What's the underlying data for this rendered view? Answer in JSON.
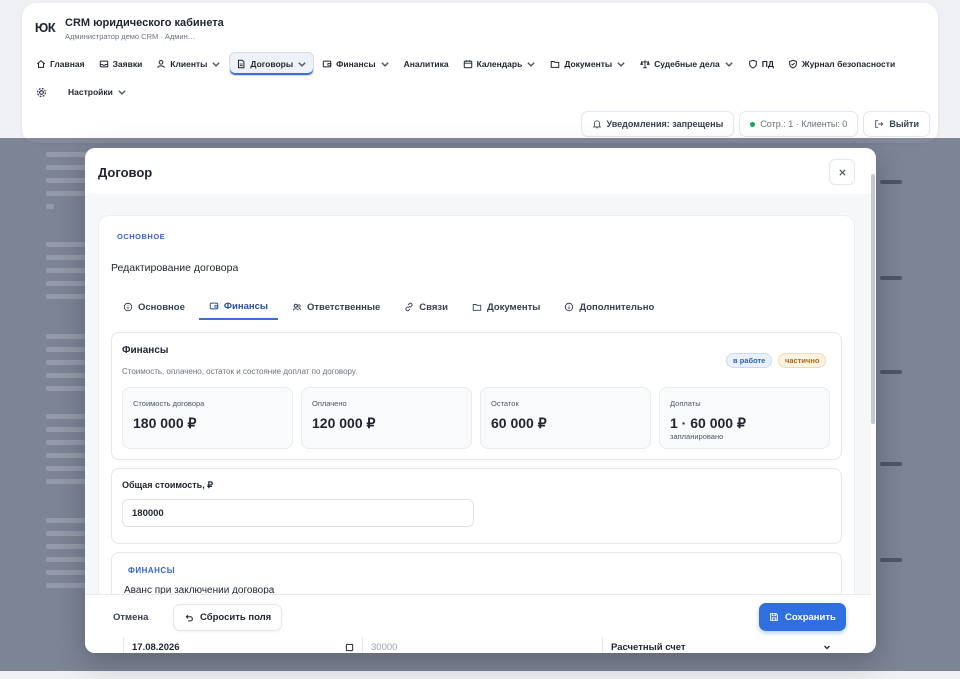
{
  "app": {
    "logo": "ЮК",
    "title": "CRM юридического кабинета",
    "subtitle": "Администратор демо CRM · Админ…"
  },
  "nav": {
    "items": [
      {
        "label": "Главная",
        "icon": "home-icon"
      },
      {
        "label": "Заявки",
        "icon": "inbox-icon"
      },
      {
        "label": "Клиенты",
        "icon": "user-icon",
        "dropdown": true
      },
      {
        "label": "Договоры",
        "icon": "document-icon",
        "dropdown": true,
        "active": true
      },
      {
        "label": "Финансы",
        "icon": "wallet-icon",
        "dropdown": true
      },
      {
        "label": "Аналитика"
      },
      {
        "label": "Календарь",
        "icon": "calendar-icon",
        "dropdown": true
      },
      {
        "label": "Документы",
        "icon": "folder-icon",
        "dropdown": true
      },
      {
        "label": "Судебные дела",
        "icon": "gavel-icon",
        "dropdown": true
      },
      {
        "label": "ПД",
        "icon": "shield-icon"
      },
      {
        "label": "Журнал безопасности",
        "icon": "shield-check-icon"
      }
    ],
    "settings_label": "Настройки"
  },
  "top_actions": {
    "notifications": "Уведомления: запрещены",
    "counts": "Сотр.: 1 · Клиенты: 0",
    "logout": "Выйти"
  },
  "modal": {
    "title": "Договор",
    "section_tag": "ОСНОВНОЕ",
    "edit_title": "Редактирование договора",
    "tabs": [
      {
        "label": "Основное",
        "icon": "info-icon"
      },
      {
        "label": "Финансы",
        "icon": "wallet-icon",
        "active": true
      },
      {
        "label": "Ответственные",
        "icon": "users-icon"
      },
      {
        "label": "Связи",
        "icon": "link-icon"
      },
      {
        "label": "Документы",
        "icon": "folder-icon"
      },
      {
        "label": "Дополнительно",
        "icon": "info-icon"
      }
    ],
    "finance": {
      "title": "Финансы",
      "description": "Стоимость, оплачено, остаток и состояние доплат по договору.",
      "badge_status": "в работе",
      "badge_payment": "частично",
      "stats": [
        {
          "label": "Стоимость договора",
          "value": "180 000 ₽"
        },
        {
          "label": "Оплачено",
          "value": "120 000 ₽"
        },
        {
          "label": "Остаток",
          "value": "60 000 ₽"
        },
        {
          "label": "Доплаты",
          "value": "1 · 60 000 ₽",
          "note": "запланировано"
        }
      ]
    },
    "cost": {
      "label": "Общая стоимость, ₽",
      "value": "180000"
    },
    "finance2": {
      "tag": "ФИНАНСЫ",
      "subtitle": "Аванс при заключении договора"
    },
    "footer": {
      "cancel": "Отмена",
      "reset": "Сбросить поля",
      "save": "Сохранить",
      "date": "17.08.2026",
      "amount_placeholder": "30000",
      "account": "Расчетный счет"
    }
  }
}
